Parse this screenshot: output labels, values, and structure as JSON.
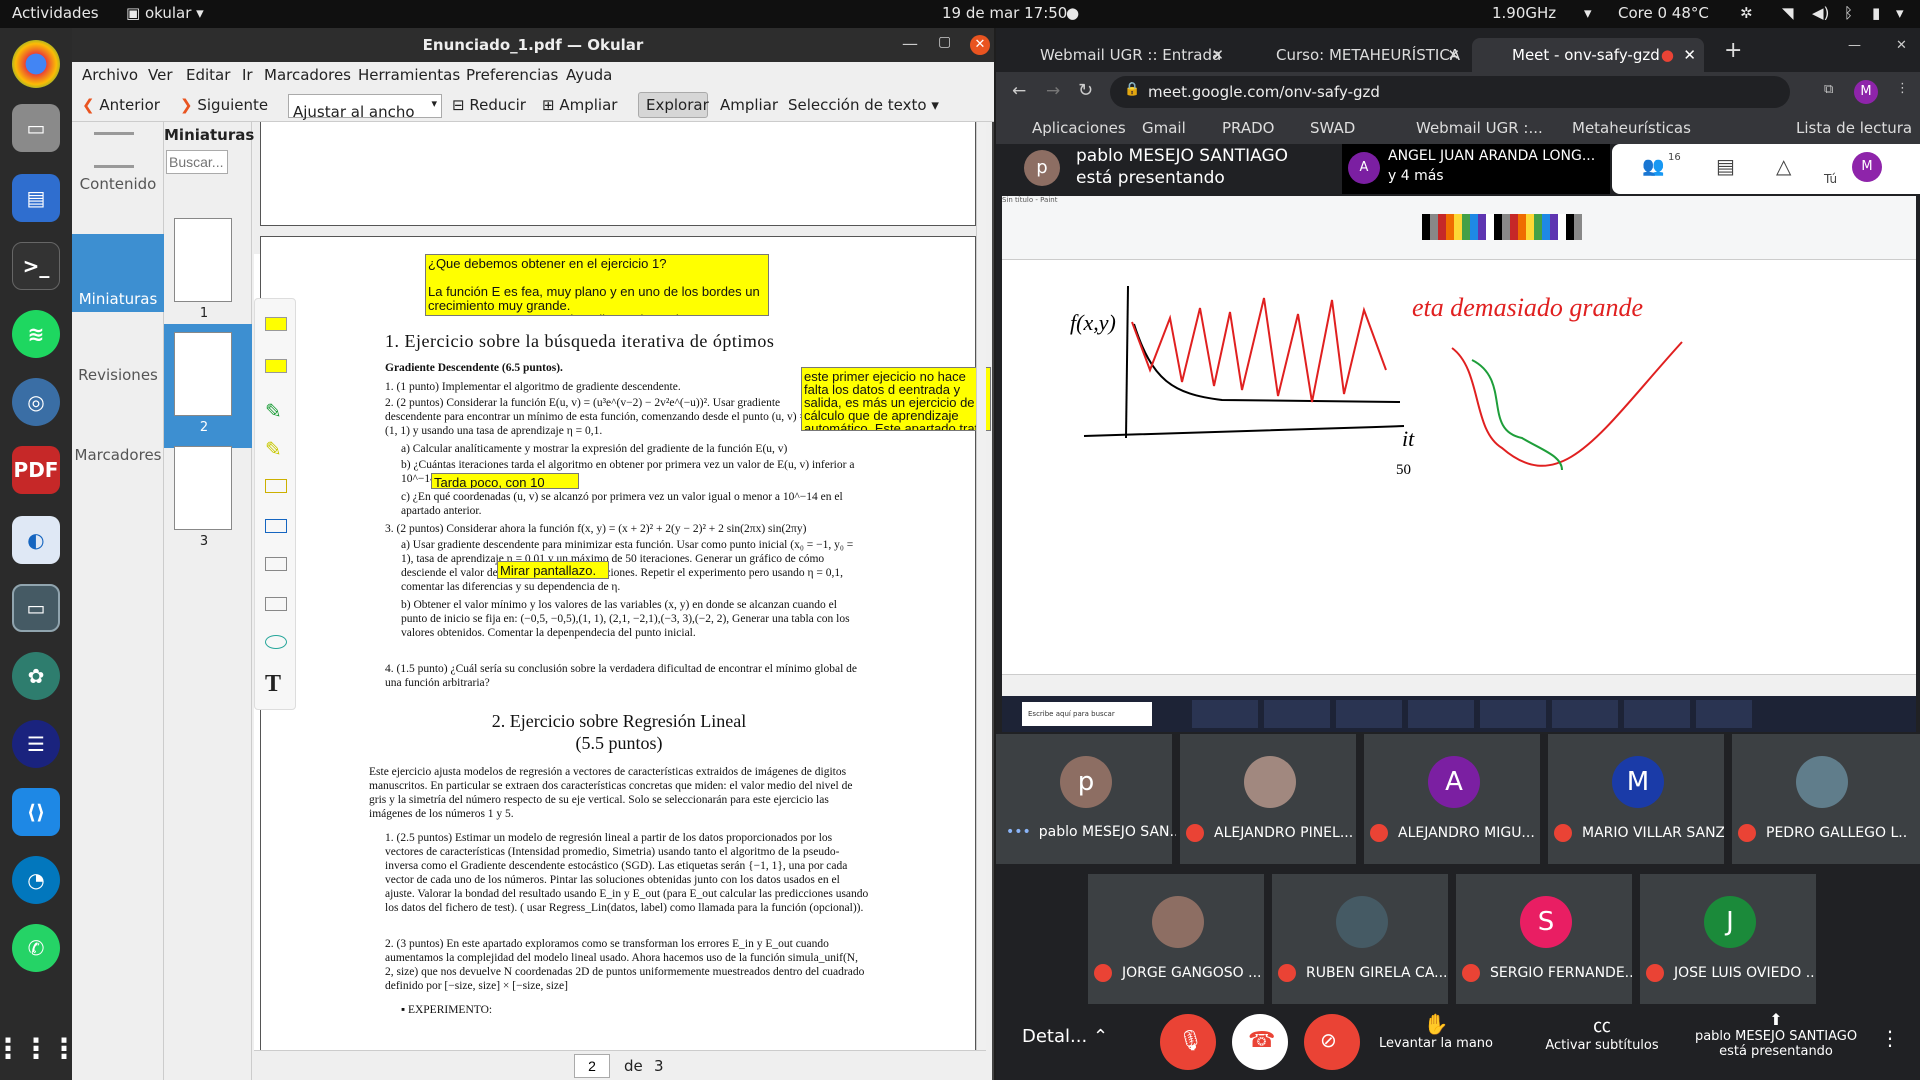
{
  "topbar": {
    "activities": "Actividades",
    "app": "okular",
    "clock": "19 de mar  17:50",
    "cpu": "1.90GHz",
    "temp": "Core 0 48°C"
  },
  "okular": {
    "title": "Enunciado_1.pdf  — Okular",
    "menu": [
      "Archivo",
      "Ver",
      "Editar",
      "Ir",
      "Marcadores",
      "Herramientas",
      "Preferencias",
      "Ayuda"
    ],
    "toolbar": {
      "prev": "Anterior",
      "next": "Siguiente",
      "zoom": "Ajustar al ancho",
      "reduce": "Reducir",
      "enlarge": "Ampliar",
      "browse": "Explorar",
      "magnify": "Ampliar",
      "selection": "Selección de texto"
    },
    "sidebar": {
      "contents": "Contenido",
      "thumbs": "Miniaturas",
      "reviews": "Revisiones",
      "bookmarks": "Marcadores"
    },
    "thumbs_panel": {
      "title": "Miniaturas",
      "search_placeholder": "Buscar...",
      "pages": [
        "1",
        "2",
        "3"
      ]
    },
    "page_nav": {
      "current": "2",
      "of": "de",
      "total": "3"
    },
    "notes": {
      "n1": "¿Que debemos obtener en el ejercicio 1?\n\nLa función E es fea, muy plano y en uno de los bordes un crecimiento muy grande.\nAunque parece que en el medio es plano, tiene una",
      "n2": "este primer ejecicio no hace falta los datos d eentrada y salida, es más un ejercicio de cálculo que de aprendizaje automático. Este apartado trata",
      "n3": "Tarda poco, con 10",
      "n4": "Mirar pantallazo."
    },
    "doc": {
      "h1": "1.   Ejercicio sobre la búsqueda iterativa de óptimos",
      "sub1": "Gradiente Descendente (6.5 puntos).",
      "i1": "1.  (1 punto) Implementar el algoritmo de gradiente descendente.",
      "i2": "2.  (2 puntos) Considerar la función E(u, v) = (u³e^(v−2) − 2v²e^(−u))². Usar gradiente descendente para encontrar un mínimo de esta función, comenzando desde el punto (u, v) = (1, 1) y usando una tasa de aprendizaje η = 0,1.",
      "i2a": "a)  Calcular analíticamente y mostrar la expresión del gradiente de la función E(u, v)",
      "i2b": "b)  ¿Cuántas iteraciones tarda el algoritmo en obtener por primera vez un valor de E(u, v) inferior a 10^−14. (Usar flotantes de 64 bits)",
      "i2c": "c)  ¿En qué coordenadas (u, v) se alcanzó por primera vez un valor igual o menor a 10^−14 en el apartado anterior.",
      "i3": "3.  (2 puntos) Considerar ahora la función f(x, y) = (x + 2)² + 2(y − 2)² + 2 sin(2πx) sin(2πy)",
      "i3a": "a)  Usar gradiente descendente para minimizar esta función. Usar como punto inicial (x₀ = −1, y₀ = 1), tasa de aprendizaje η = 0,01 y un máximo de 50 iteraciones. Generar un gráfico de cómo desciende el valor de la función con las iteraciones. Repetir el experimento pero usando η = 0,1, comentar las diferencias y su dependencia de η.",
      "i3b": "b)  Obtener el valor mínimo y los valores de las variables (x, y) en donde se alcanzan cuando el punto de inicio se fija en: (−0,5, −0,5),(1, 1), (2,1, −2,1),(−3, 3),(−2, 2), Generar una tabla con los valores obtenidos. Comentar la depenpendecia del punto inicial.",
      "i4": "4.  (1.5 punto) ¿Cuál sería su conclusión sobre la verdadera dificultad de encontrar el mínimo global de una función arbitraria?",
      "h2a": "2.   Ejercicio sobre Regresión Lineal",
      "h2b": "(5.5 puntos)",
      "p2": "Este ejercicio ajusta modelos de regresión a vectores de características extraidos de imágenes de digitos manuscritos. En particular se extraen dos características concretas que miden: el valor medio del nivel de gris y la simetría del número respecto de su eje vertical. Solo se seleccionarán para este ejercicio las imágenes de los números 1 y 5.",
      "r1": "1.  (2.5 puntos) Estimar un modelo de regresión lineal a partir de los datos proporcionados por los vectores de características (Intensidad promedio, Simetria) usando tanto el algoritmo de la pseudo-inversa como el Gradiente descendente estocástico (SGD). Las etiquetas serán {−1, 1}, una por cada vector de cada uno de los números. Pintar las soluciones obtenidas junto con los datos usados en el ajuste. Valorar la bondad del resultado usando E_in y E_out (para E_out calcular las predicciones usando los datos del fichero de test). ( usar Regress_Lin(datos, label) como llamada para la función (opcional)).",
      "r2": "2.  (3 puntos) En este apartado exploramos como se transforman los errores E_in y E_out cuando aumentamos la complejidad del modelo lineal usado. Ahora hacemos uso de la función simula_unif(N, 2, size) que nos devuelve N coordenadas 2D de puntos uniformemente muestreados dentro del cuadrado definido por [−size, size] × [−size, size]",
      "exp": "▪  EXPERIMENTO:"
    }
  },
  "chrome": {
    "tabs": [
      "Webmail UGR :: Entrada",
      "Curso: METAHEURÍSTICA",
      "Meet - onv-safy-gzd"
    ],
    "url": "meet.google.com/onv-safy-gzd",
    "bookmarks": [
      "Aplicaciones",
      "Gmail",
      "PRADO",
      "SWAD",
      "Webmail UGR :...",
      "Metaheurísticas",
      "Lista de lectura"
    ],
    "presenter": {
      "name": "pablo MESEJO SANTIAGO",
      "status": "está presentando",
      "other": "ANGEL JUAN ARANDA LONG...",
      "more": "y 4 más",
      "count": "16",
      "you": "Tú"
    },
    "paint": {
      "ylabel": "f(x,y)",
      "xlabel": "it",
      "tick": "50",
      "note": "eta demasiado grande",
      "app": "Sin título - Paint",
      "search": "Escribe aquí para buscar"
    },
    "participants": [
      {
        "name": "pablo MESEJO SAN...",
        "initial": "p",
        "color": "#8d6e63"
      },
      {
        "name": "ALEJANDRO PINEL...",
        "initial": "",
        "color": "#a1887f"
      },
      {
        "name": "ALEJANDRO MIGU...",
        "initial": "A",
        "color": "#7b1fa2"
      },
      {
        "name": "MARIO VILLAR SANZ",
        "initial": "M",
        "color": "#1a3ba8"
      },
      {
        "name": "PEDRO GALLEGO L...",
        "initial": "",
        "color": "#607d8b"
      },
      {
        "name": "JORGE GANGOSO ...",
        "initial": "",
        "color": "#8d6e63"
      },
      {
        "name": "RUBEN GIRELA CA...",
        "initial": "",
        "color": "#455a64"
      },
      {
        "name": "SERGIO FERNANDE...",
        "initial": "S",
        "color": "#e91e63"
      },
      {
        "name": "JOSE LUIS OVIEDO ...",
        "initial": "J",
        "color": "#1b8a3a"
      }
    ],
    "controls": {
      "details": "Detal...",
      "raise": "Levantar la mano",
      "captions": "Activar subtítulos",
      "presenting": "pablo MESEJO SANTIAGO",
      "presenting2": "está presentando"
    }
  }
}
